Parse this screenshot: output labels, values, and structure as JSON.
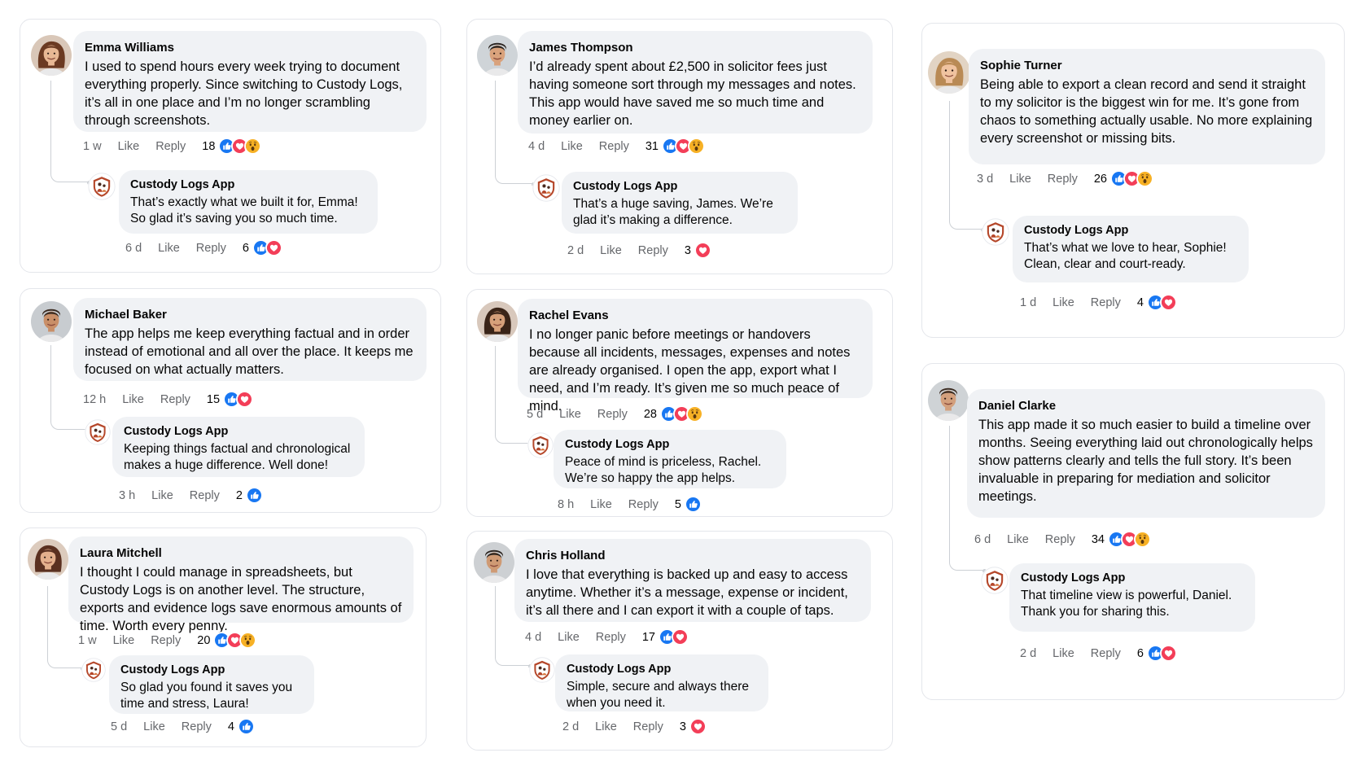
{
  "colors": {
    "like": "#1877f2",
    "love": "#f33e58",
    "wow": "#f7b125",
    "bubble": "#f0f2f5",
    "meta": "#65676b",
    "brand": "#b5472a"
  },
  "actions": {
    "like": "Like",
    "reply": "Reply"
  },
  "brand_name": "Custody Logs App",
  "comments": [
    {
      "author": "Emma Williams",
      "text": "I used to spend hours every week trying to document everything properly. Since switching to Custody Logs, it’s all in one place and I’m no longer scrambling through screenshots.",
      "time": "1 w",
      "count": "18",
      "reactions": [
        "like",
        "love",
        "wow"
      ],
      "reply": {
        "text": "That’s exactly what we built it for, Emma! So glad it’s saving you so much time.",
        "time": "6 d",
        "count": "6",
        "reactions": [
          "like",
          "love"
        ]
      }
    },
    {
      "author": "James Thompson",
      "text": "I’d already spent about £2,500 in solicitor fees just having someone sort through my messages and notes. This app would have saved me so much time and money earlier on.",
      "time": "4 d",
      "count": "31",
      "reactions": [
        "like",
        "love",
        "wow"
      ],
      "reply": {
        "text": "That’s a huge saving, James. We’re glad it’s making a difference.",
        "time": "2 d",
        "count": "3",
        "reactions": [
          "love"
        ]
      }
    },
    {
      "author": "Sophie Turner",
      "text": "Being able to export a clean record and send it straight to my solicitor is the biggest win for me. It’s gone from chaos to something actually usable. No more explaining every screenshot or missing bits.",
      "time": "3 d",
      "count": "26",
      "reactions": [
        "like",
        "love",
        "wow"
      ],
      "reply": {
        "text": "That’s what we love to hear, Sophie! Clean, clear and court-ready.",
        "time": "1 d",
        "count": "4",
        "reactions": [
          "like",
          "love"
        ]
      }
    },
    {
      "author": "Michael Baker",
      "text": "The app helps me keep everything factual and in order instead of emotional and all over the place. It keeps me focused on what actually matters.",
      "time": "12 h",
      "count": "15",
      "reactions": [
        "like",
        "love"
      ],
      "reply": {
        "text": "Keeping things factual and chronological makes a huge difference. Well done!",
        "time": "3 h",
        "count": "2",
        "reactions": [
          "like"
        ]
      }
    },
    {
      "author": "Rachel Evans",
      "text": "I no longer panic before meetings or handovers because all incidents, messages, expenses and notes are already organised. I open the app, export what I need, and I’m ready. It’s given me so much peace of mind.",
      "time": "5 d",
      "count": "28",
      "reactions": [
        "like",
        "love",
        "wow"
      ],
      "reply": {
        "text": "Peace of mind is priceless, Rachel. We’re so happy the app helps.",
        "time": "8 h",
        "count": "5",
        "reactions": [
          "like"
        ]
      }
    },
    {
      "author": "Daniel Clarke",
      "text": "This app made it so much easier to build a timeline over months. Seeing everything laid out chronologically helps show patterns clearly and tells the full story. It’s been invaluable in preparing for mediation and solicitor meetings.",
      "time": "6 d",
      "count": "34",
      "reactions": [
        "like",
        "love",
        "wow"
      ],
      "reply": {
        "text": "That timeline view is powerful, Daniel. Thank you for sharing this.",
        "time": "2 d",
        "count": "6",
        "reactions": [
          "like",
          "love"
        ]
      }
    },
    {
      "author": "Laura Mitchell",
      "text": "I thought I could manage in spreadsheets, but Custody Logs is on another level. The structure, exports and evidence logs save enormous amounts of time. Worth every penny.",
      "time": "1 w",
      "count": "20",
      "reactions": [
        "like",
        "love",
        "wow"
      ],
      "reply": {
        "text": "So glad you found it saves you time and stress, Laura!",
        "time": "5 d",
        "count": "4",
        "reactions": [
          "like"
        ]
      }
    },
    {
      "author": "Chris Holland",
      "text": "I love that everything is backed up and easy to access anytime. Whether it’s a message, expense or incident, it’s all there and I can export it with a couple of taps.",
      "time": "4 d",
      "count": "17",
      "reactions": [
        "like",
        "love"
      ],
      "reply": {
        "text": "Simple, secure and always there when you need it.",
        "time": "2 d",
        "count": "3",
        "reactions": [
          "love"
        ]
      }
    }
  ]
}
